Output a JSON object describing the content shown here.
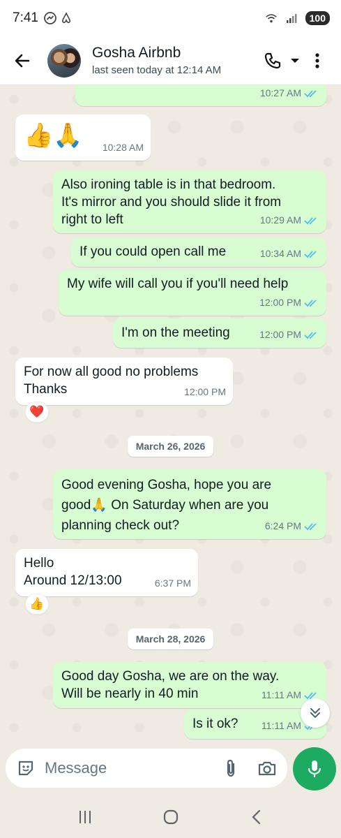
{
  "status_bar": {
    "time": "7:41",
    "battery": "100",
    "icons": [
      "messenger-icon",
      "airbnb-icon",
      "wifi-icon",
      "signal-icon"
    ]
  },
  "header": {
    "name": "Gosha Airbnb",
    "last_seen": "last seen today at 12:14 AM"
  },
  "messages": [
    {
      "dir": "out",
      "text": "",
      "time": "10:27 AM",
      "read": true
    },
    {
      "dir": "in",
      "text": "👍🙏",
      "time": "10:28 AM"
    },
    {
      "dir": "out",
      "text": "Also ironing table is in that bedroom.\nIt's mirror and you should slide it from\nright to left",
      "time": "10:29 AM",
      "read": true
    },
    {
      "dir": "out",
      "text": "If you could open call me",
      "time": "10:34 AM",
      "read": true
    },
    {
      "dir": "out",
      "text": "My wife will call you if you'll need help",
      "time": "12:00 PM",
      "read": true
    },
    {
      "dir": "out",
      "text": "I'm on the meeting",
      "time": "12:00 PM",
      "read": true
    },
    {
      "dir": "in",
      "text": "For now all good no problems\nThanks",
      "time": "12:00 PM",
      "reaction": "❤️"
    },
    {
      "date": "March 26, 2026"
    },
    {
      "dir": "out",
      "text": "Good evening Gosha,  hope you are\ngood🙏 On Saturday when are you\nplanning check out?",
      "time": "6:24 PM",
      "read": true
    },
    {
      "dir": "in",
      "text": "Hello\nAround 12/13:00",
      "time": "6:37 PM",
      "reaction": "👍"
    },
    {
      "date": "March 28, 2026"
    },
    {
      "dir": "out",
      "text": "Good day Gosha, we are on the way.\nWill be nearly in 40 min",
      "time": "11:11 AM",
      "read": true
    },
    {
      "dir": "out",
      "text": "Is it ok?",
      "time": "11:11 AM",
      "read": true
    }
  ],
  "composer": {
    "placeholder": "Message"
  },
  "colors": {
    "outgoing_bubble": "#d9fdd3",
    "incoming_bubble": "#ffffff",
    "read_ticks": "#53bdeb",
    "mic_button": "#1daa61",
    "chat_background": "#efeae2"
  }
}
